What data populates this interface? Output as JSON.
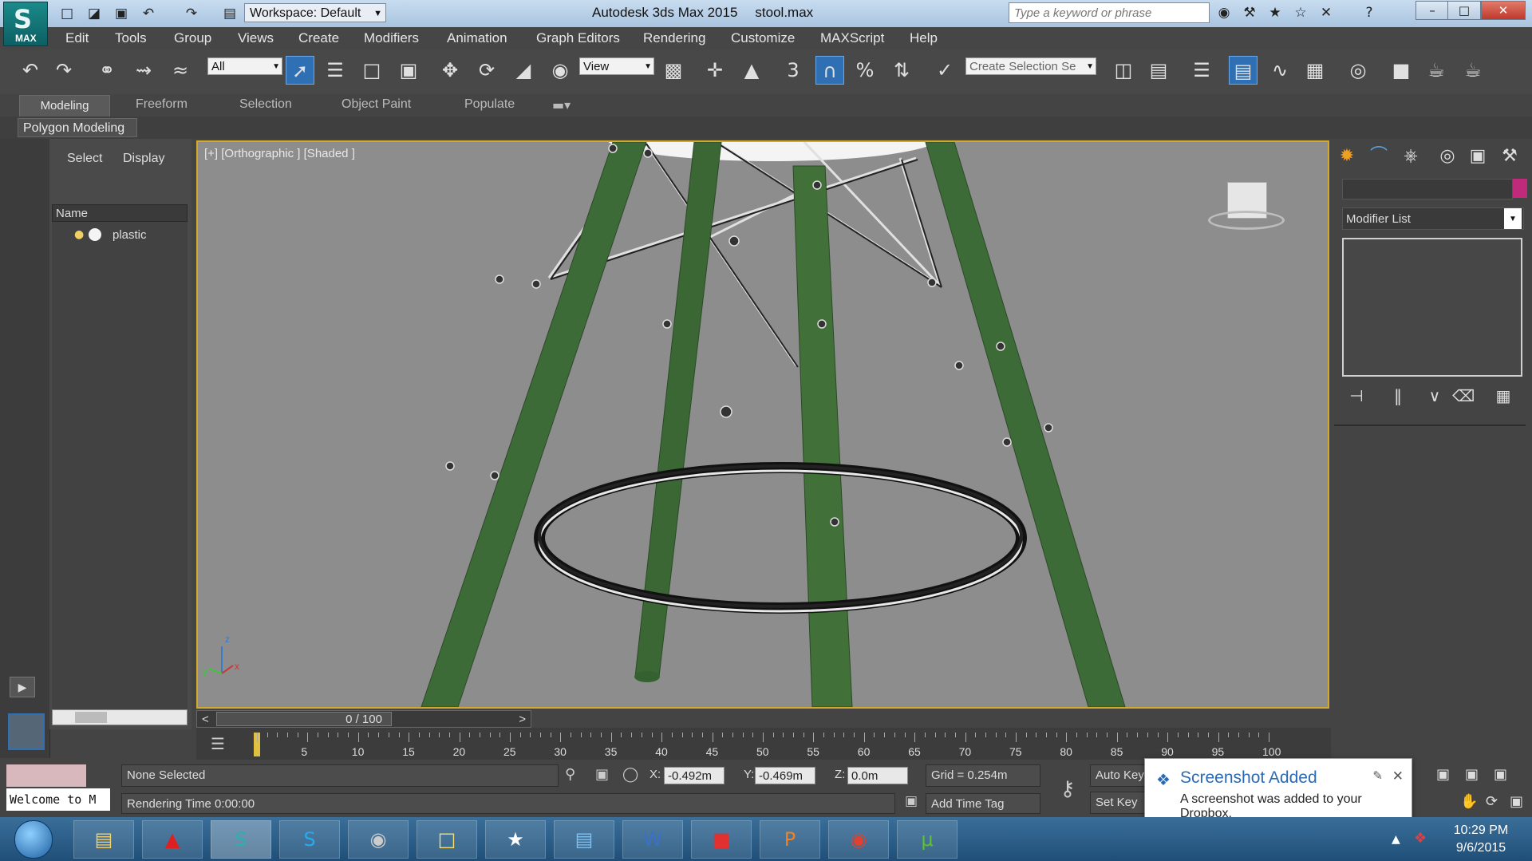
{
  "app": {
    "logo_text": "MAX",
    "window_title": "Autodesk 3ds Max 2015",
    "file_name": "stool.max",
    "workspace": "Workspace: Default",
    "search_placeholder": "Type a keyword or phrase"
  },
  "menu": [
    "Edit",
    "Tools",
    "Group",
    "Views",
    "Create",
    "Modifiers",
    "Animation",
    "Graph Editors",
    "Rendering",
    "Customize",
    "MAXScript",
    "Help"
  ],
  "toolbar": {
    "selection_filter": "All",
    "ref_coord": "View",
    "named_selection_placeholder": "Create Selection Se",
    "snap_label": "3"
  },
  "ribbon": {
    "tabs": [
      "Modeling",
      "Freeform",
      "Selection",
      "Object Paint",
      "Populate"
    ],
    "panel_label": "Polygon Modeling"
  },
  "scene_explorer": {
    "tabs": [
      "Select",
      "Display"
    ],
    "column_name": "Name",
    "items": [
      "plastic"
    ]
  },
  "viewport": {
    "label": "[+] [Orthographic ] [Shaded ]",
    "axis_z": "z",
    "axis_x": "x",
    "axis_y": "y",
    "leg_color": "#3d6b37",
    "bg_color": "#8d8d8d"
  },
  "command_panel": {
    "modifier_list": "Modifier List",
    "object_color": "#c02a7a"
  },
  "timeline": {
    "frame_label": "0 / 100",
    "prev": "<",
    "next": ">",
    "ticks": [
      "5",
      "10",
      "15",
      "20",
      "25",
      "30",
      "35",
      "40",
      "45",
      "50",
      "55",
      "60",
      "65",
      "70",
      "75",
      "80",
      "85",
      "90",
      "95",
      "100"
    ]
  },
  "status": {
    "selection": "None Selected",
    "rendering_time": "Rendering Time  0:00:00",
    "welcome": "Welcome to M",
    "x_label": "X:",
    "x_value": "-0.492m",
    "y_label": "Y:",
    "y_value": "-0.469m",
    "z_label": "Z:",
    "z_value": "0.0m",
    "grid": "Grid = 0.254m",
    "auto_key": "Auto Key",
    "set_key": "Set Key",
    "add_time_tag": "Add Time Tag"
  },
  "toast": {
    "title": "Screenshot Added",
    "message": "A screenshot was added to your Dropbox."
  },
  "clock": {
    "time": "10:29 PM",
    "date": "9/6/2015"
  }
}
